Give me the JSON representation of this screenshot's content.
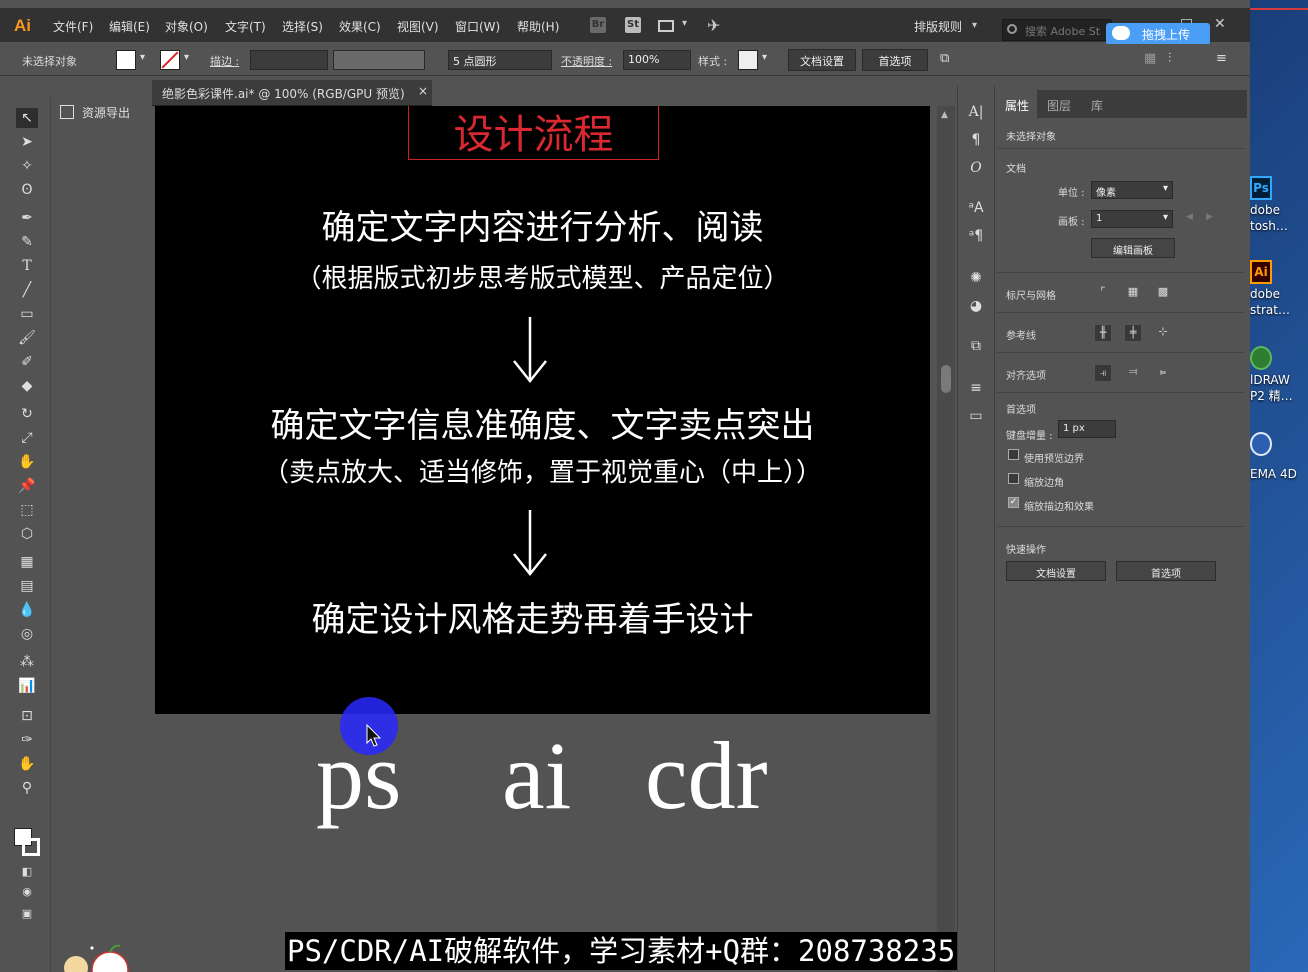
{
  "desktop": {
    "icons": [
      {
        "name": "photoshop",
        "glyph": "Ps",
        "label": "dobe\ntosh…",
        "color": "#31a8ff"
      },
      {
        "name": "illustrator",
        "glyph": "Ai",
        "label": "dobe\nstrat…",
        "color": "#ff9a00"
      },
      {
        "name": "coreldraw",
        "glyph": "",
        "label": "lDRAW\nP2 精…",
        "color": "#5cb85c"
      },
      {
        "name": "cinema4d",
        "glyph": "",
        "label": "EMA 4D",
        "color": "#3a7fd4"
      }
    ]
  },
  "menubar": {
    "logo": "Ai",
    "items": [
      "文件(F)",
      "编辑(E)",
      "对象(O)",
      "文字(T)",
      "选择(S)",
      "效果(C)",
      "视图(V)",
      "窗口(W)",
      "帮助(H)"
    ],
    "st_icon": "St",
    "workspace": "排版规则",
    "search_placeholder": "搜索 Adobe St",
    "upload_button": "拖拽上传"
  },
  "controlbar": {
    "no_selection": "未选择对象",
    "stroke_label": "描边 :",
    "brush": "5 点圆形",
    "opacity_label": "不透明度 :",
    "opacity_value": "100%",
    "style_label": "样式 :",
    "doc_setup": "文档设置",
    "preferences": "首选项"
  },
  "left_panel": {
    "asset_export": "资源导出"
  },
  "document_tab": {
    "title": "绝影色彩课件.ai* @ 100% (RGB/GPU 预览)",
    "close": "×"
  },
  "artboard": {
    "title": "设计流程",
    "line1": "确定文字内容进行分析、阅读",
    "line2": "（根据版式初步思考版式模型、产品定位）",
    "line3": "确定文字信息准确度、文字卖点突出",
    "line4": "（卖点放大、适当修饰，置于视觉重心（中上））",
    "line5": "确定设计风格走势再着手设计"
  },
  "canvas_text": {
    "ps": "ps",
    "ai": "ai",
    "cdr": "cdr"
  },
  "properties": {
    "tabs": [
      "属性",
      "图层",
      "库"
    ],
    "active_tab": "属性",
    "no_selection": "未选择对象",
    "document_section": "文档",
    "unit_label": "单位 :",
    "unit_value": "像素",
    "artboard_label": "画板 :",
    "artboard_value": "1",
    "edit_artboards": "编辑画板",
    "rulers_grids": "标尺与网格",
    "guides": "参考线",
    "snap_options": "对齐选项",
    "preferences_section": "首选项",
    "keyboard_increment_label": "键盘增量 :",
    "keyboard_increment_value": "1 px",
    "use_preview_bounds": "使用预览边界",
    "use_preview_bounds_checked": false,
    "scale_corners": "缩放边角",
    "scale_corners_checked": false,
    "scale_strokes": "缩放描边和效果",
    "scale_strokes_checked": true,
    "quick_actions": "快速操作",
    "doc_setup": "文档设置",
    "preferences": "首选项"
  },
  "caption": "PS/CDR/AI破解软件，学习素材+Q群：208738235",
  "colors": {
    "accent_red": "#d9282f",
    "upload_blue": "#4a9ef5",
    "cursor_highlight": "#2828ff"
  }
}
